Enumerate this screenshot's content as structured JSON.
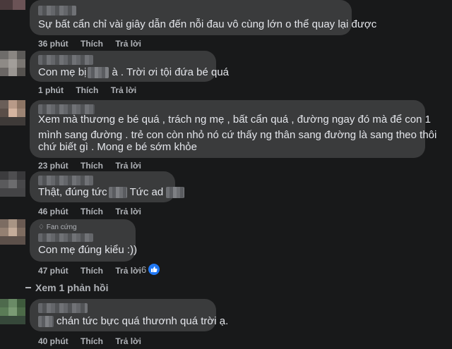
{
  "colors": {
    "bubble": "#3a3b3c",
    "background": "#18191a",
    "like_blue": "#2078f4",
    "meta_text": "#b0b3b8"
  },
  "comments": [
    {
      "text": "Sự bất cẩn chỉ vài giây dẫn đến nỗi đau vô cùng lớn o thể quay lại được",
      "time": "36 phút",
      "like": "Thích",
      "reply": "Trả lời"
    },
    {
      "text_a": "Con mẹ bị",
      "text_b": "à . Trời ơi tội đứa bé quá",
      "time": "1 phút",
      "like": "Thích",
      "reply": "Trả lời"
    },
    {
      "lines": [
        "Xem mà thương e bé quá , trách ng mẹ , bất cẩn quá , đường ngay đó mà để con 1",
        "mình sang đường . trẻ con còn nhỏ nó cứ thấy ng thân sang đường là sang theo thôi",
        "chứ biết gì . Mong e bé sớm khỏe"
      ],
      "time": "23 phút",
      "like": "Thích",
      "reply": "Trả lời"
    },
    {
      "text_a": "Thật, đúng tức",
      "text_b": "Tức ad",
      "time": "46 phút",
      "like": "Thích",
      "reply": "Trả lời"
    },
    {
      "badge": "Fan cứng",
      "text": "Con mẹ đúng kiểu :))",
      "time": "47 phút",
      "like": "Thích",
      "reply": "Trả lời",
      "reactions": "6"
    },
    {
      "text": "chán tức bực quá thươnh quá trời ạ.",
      "time": "40 phút",
      "like": "Thích",
      "reply": "Trả lời"
    }
  ],
  "view_replies": "Xem 1 phản hồi"
}
